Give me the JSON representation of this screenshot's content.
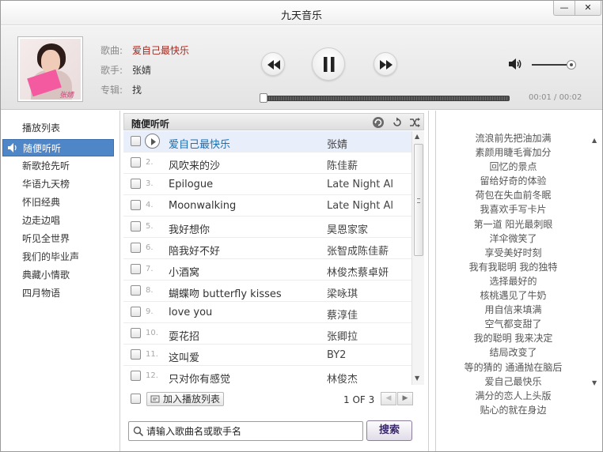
{
  "window": {
    "title": "九天音乐",
    "minimize_glyph": "—",
    "close_glyph": "✕"
  },
  "now_playing": {
    "title_label": "歌曲:",
    "title": "爱自己最快乐",
    "artist_label": "歌手:",
    "artist": "张婧",
    "album_label": "专辑:",
    "album": "找",
    "album_logo_text": "张婧",
    "elapsed": "00:01",
    "duration": "00:02",
    "time_separator": " / ",
    "progress_fraction": 0.01,
    "volume_fraction": 0.88
  },
  "controls": {
    "prev_icon": "previous-icon",
    "play_icon": "pause-icon",
    "next_icon": "next-icon",
    "volume_icon": "speaker-icon"
  },
  "sidebar": {
    "items": [
      {
        "label": "播放列表"
      },
      {
        "label": "随便听听",
        "active": true
      },
      {
        "label": "新歌抢先听"
      },
      {
        "label": "华语九天榜"
      },
      {
        "label": "怀旧经典"
      },
      {
        "label": "边走边唱"
      },
      {
        "label": "听见全世界"
      },
      {
        "label": "我们的毕业声"
      },
      {
        "label": "典藏小情歌"
      },
      {
        "label": "四月物语"
      }
    ]
  },
  "playlist": {
    "title": "随便听听",
    "header_icons": [
      "refresh-icon",
      "loop-icon",
      "shuffle-icon"
    ],
    "rows": [
      {
        "num": "1.",
        "song": "爱自己最快乐",
        "artist": "张婧",
        "playing": true
      },
      {
        "num": "2.",
        "song": "风吹来的沙",
        "artist": "陈佳薪"
      },
      {
        "num": "3.",
        "song": "Epilogue",
        "artist": "Late Night Al"
      },
      {
        "num": "4.",
        "song": "Moonwalking",
        "artist": "Late Night Al"
      },
      {
        "num": "5.",
        "song": "我好想你",
        "artist": "昊恩家家"
      },
      {
        "num": "6.",
        "song": "陪我好不好",
        "artist": "张智成陈佳薪"
      },
      {
        "num": "7.",
        "song": "小酒窝",
        "artist": "林俊杰蔡卓妍"
      },
      {
        "num": "8.",
        "song": "蝴蝶吻 butterfly kisses",
        "artist": "梁咏琪"
      },
      {
        "num": "9.",
        "song": "love you",
        "artist": "蔡淳佳"
      },
      {
        "num": "10.",
        "song": "耍花招",
        "artist": "张卿拉"
      },
      {
        "num": "11.",
        "song": "这叫爱",
        "artist": "BY2"
      },
      {
        "num": "12.",
        "song": "只对你有感觉",
        "artist": "林俊杰"
      }
    ],
    "add_button": "加入播放列表",
    "pager_text": "1 OF 3",
    "pager_prev": "◀",
    "pager_next": "▶",
    "scroll_up": "▲",
    "scroll_down": "▼"
  },
  "search": {
    "placeholder": "请输入歌曲名或歌手名",
    "button": "搜索"
  },
  "lyrics": {
    "lines": [
      "流浪前先把油加满",
      "素颜用睫毛膏加分",
      "回忆的景点",
      "留给好奇的体验",
      "荷包在失血前冬眠",
      "我喜欢手写卡片",
      "第一道 阳光最刺眼",
      "洋伞微笑了",
      "享受美好时刻",
      "我有我聪明 我的独特",
      "选择最好的",
      "核桃遇见了牛奶",
      "用自信来填满",
      "空气都变甜了",
      "我的聪明 我来决定",
      "结局改变了",
      "等的猜的 通通抛在脑后",
      "爱自己最快乐",
      "满分的恋人上头版",
      "贴心的就在身边"
    ],
    "scroll_up": "▲",
    "scroll_down": "▼"
  }
}
